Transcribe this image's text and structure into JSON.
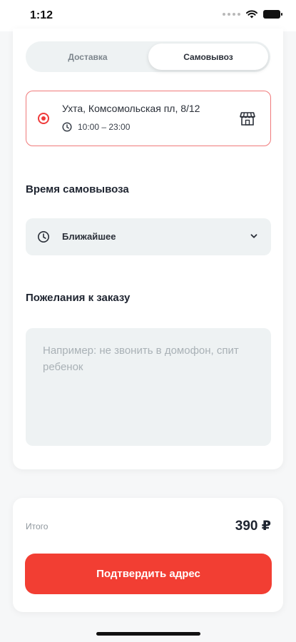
{
  "status_bar": {
    "time": "1:12"
  },
  "tabs": [
    {
      "label": "Доставка",
      "active": false
    },
    {
      "label": "Самовывоз",
      "active": true
    }
  ],
  "pickup_point": {
    "address": "Ухта, Комсомольская пл, 8/12",
    "hours": "10:00 – 23:00",
    "selected": true
  },
  "pickup_time": {
    "title": "Время самовывоза",
    "value": "Ближайшее"
  },
  "wishes": {
    "title": "Пожелания к заказу",
    "placeholder": "Например: не звонить в домофон, спит ребенок",
    "value": ""
  },
  "summary": {
    "total_label": "Итого",
    "total_value": "390 ₽"
  },
  "confirm_button": {
    "label": "Подтвердить адрес"
  },
  "colors": {
    "accent": "#f23e33",
    "selected_border": "#f0797a",
    "field_bg": "#eef2f3"
  },
  "icons": [
    "wifi-icon",
    "battery-icon",
    "radio-selected-icon",
    "clock-icon",
    "store-icon",
    "chevron-down-icon"
  ]
}
